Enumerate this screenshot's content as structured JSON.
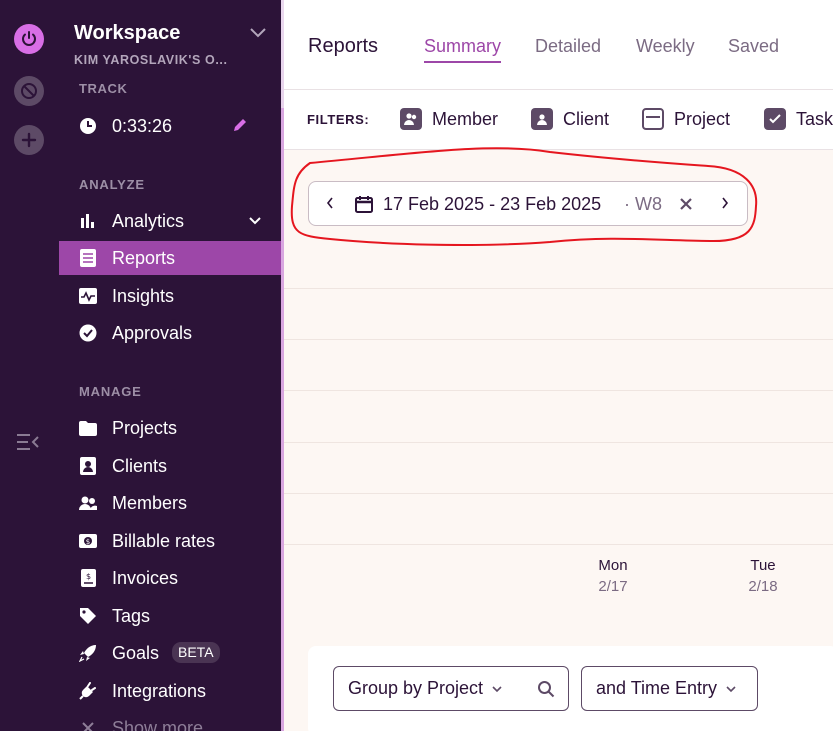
{
  "sidebar": {
    "workspace_title": "Workspace",
    "workspace_owner": "KIM YAROSLAVIK'S O...",
    "track_label": "TRACK",
    "timer_value": "0:33:26",
    "analyze_label": "ANALYZE",
    "manage_label": "MANAGE",
    "items": {
      "analytics": "Analytics",
      "reports": "Reports",
      "insights": "Insights",
      "approvals": "Approvals",
      "projects": "Projects",
      "clients": "Clients",
      "members": "Members",
      "billable_rates": "Billable rates",
      "invoices": "Invoices",
      "tags": "Tags",
      "goals": "Goals",
      "goals_badge": "BETA",
      "integrations": "Integrations",
      "show_more": "Show more"
    }
  },
  "header": {
    "title": "Reports",
    "tabs": [
      "Summary",
      "Detailed",
      "Weekly",
      "Saved"
    ],
    "active_tab": "Summary"
  },
  "filters": {
    "label": "FILTERS:",
    "items": [
      "Member",
      "Client",
      "Project",
      "Task"
    ]
  },
  "date_range": {
    "range": "17 Feb 2025 - 23 Feb 2025",
    "week": "· W8"
  },
  "chart_days": [
    {
      "name": "Mon",
      "date": "2/17"
    },
    {
      "name": "Tue",
      "date": "2/18"
    }
  ],
  "grouping": {
    "group_by": "Group by Project",
    "then_by": "and Time Entry"
  },
  "colors": {
    "sidebar_bg": "#2c1338",
    "accent": "#9d47a8",
    "annotation": "#e5161f"
  }
}
